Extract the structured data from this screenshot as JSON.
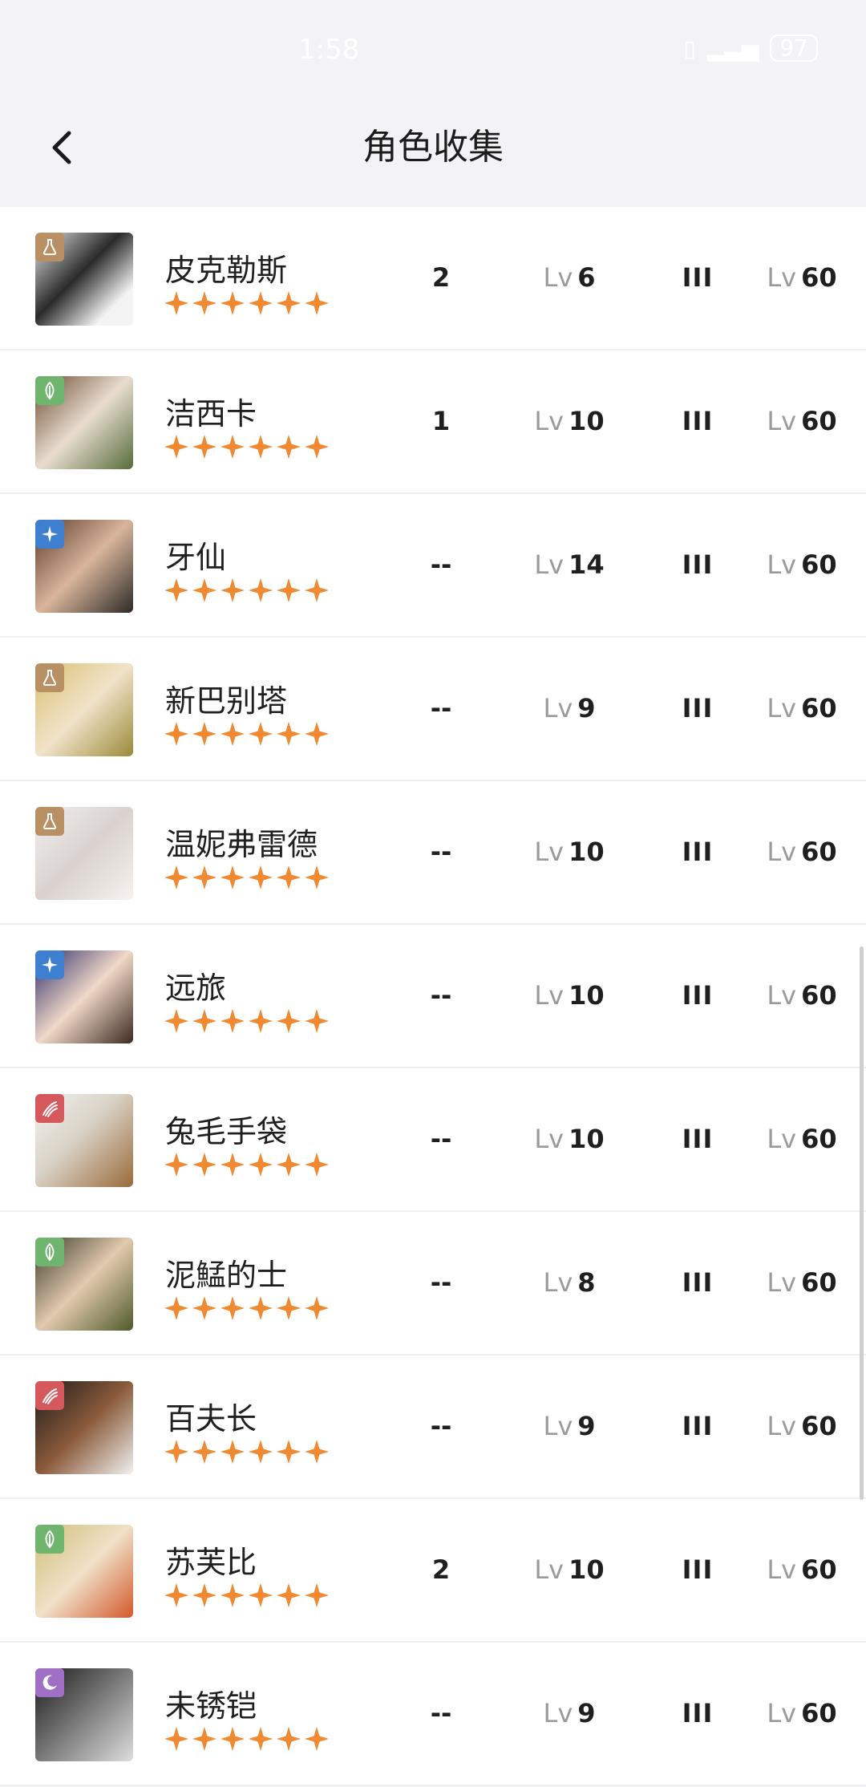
{
  "status_bar": {
    "time": "1:58",
    "battery": "97"
  },
  "nav": {
    "title": "角色收集"
  },
  "columns": {
    "level_prefix": "Lv"
  },
  "colors": {
    "star": "#f08a32",
    "badge_brown": "#b98f64",
    "badge_green": "#6fb56d",
    "badge_blue": "#3f7fd0",
    "badge_red": "#d5595c",
    "badge_purple": "#a070c6"
  },
  "characters": [
    {
      "name": "皮克勒斯",
      "element_icon": "flask-icon",
      "stars": 6,
      "count": "2",
      "level": "6",
      "rank": "III",
      "max_level": "60"
    },
    {
      "name": "洁西卡",
      "element_icon": "leaf-icon",
      "stars": 6,
      "count": "1",
      "level": "10",
      "rank": "III",
      "max_level": "60"
    },
    {
      "name": "牙仙",
      "element_icon": "sparkle-icon",
      "stars": 6,
      "count": "--",
      "level": "14",
      "rank": "III",
      "max_level": "60"
    },
    {
      "name": "新巴别塔",
      "element_icon": "flask-icon",
      "stars": 6,
      "count": "--",
      "level": "9",
      "rank": "III",
      "max_level": "60"
    },
    {
      "name": "温妮弗雷德",
      "element_icon": "flask-icon",
      "stars": 6,
      "count": "--",
      "level": "10",
      "rank": "III",
      "max_level": "60"
    },
    {
      "name": "远旅",
      "element_icon": "sparkle-icon",
      "stars": 6,
      "count": "--",
      "level": "10",
      "rank": "III",
      "max_level": "60"
    },
    {
      "name": "兔毛手袋",
      "element_icon": "claw-icon",
      "stars": 6,
      "count": "--",
      "level": "10",
      "rank": "III",
      "max_level": "60"
    },
    {
      "name": "泥鯭的士",
      "element_icon": "leaf-icon",
      "stars": 6,
      "count": "--",
      "level": "8",
      "rank": "III",
      "max_level": "60"
    },
    {
      "name": "百夫长",
      "element_icon": "claw-icon",
      "stars": 6,
      "count": "--",
      "level": "9",
      "rank": "III",
      "max_level": "60"
    },
    {
      "name": "苏芙比",
      "element_icon": "leaf-icon",
      "stars": 6,
      "count": "2",
      "level": "10",
      "rank": "III",
      "max_level": "60"
    },
    {
      "name": "未锈铠",
      "element_icon": "moon-icon",
      "stars": 6,
      "count": "--",
      "level": "9",
      "rank": "III",
      "max_level": "60"
    }
  ]
}
